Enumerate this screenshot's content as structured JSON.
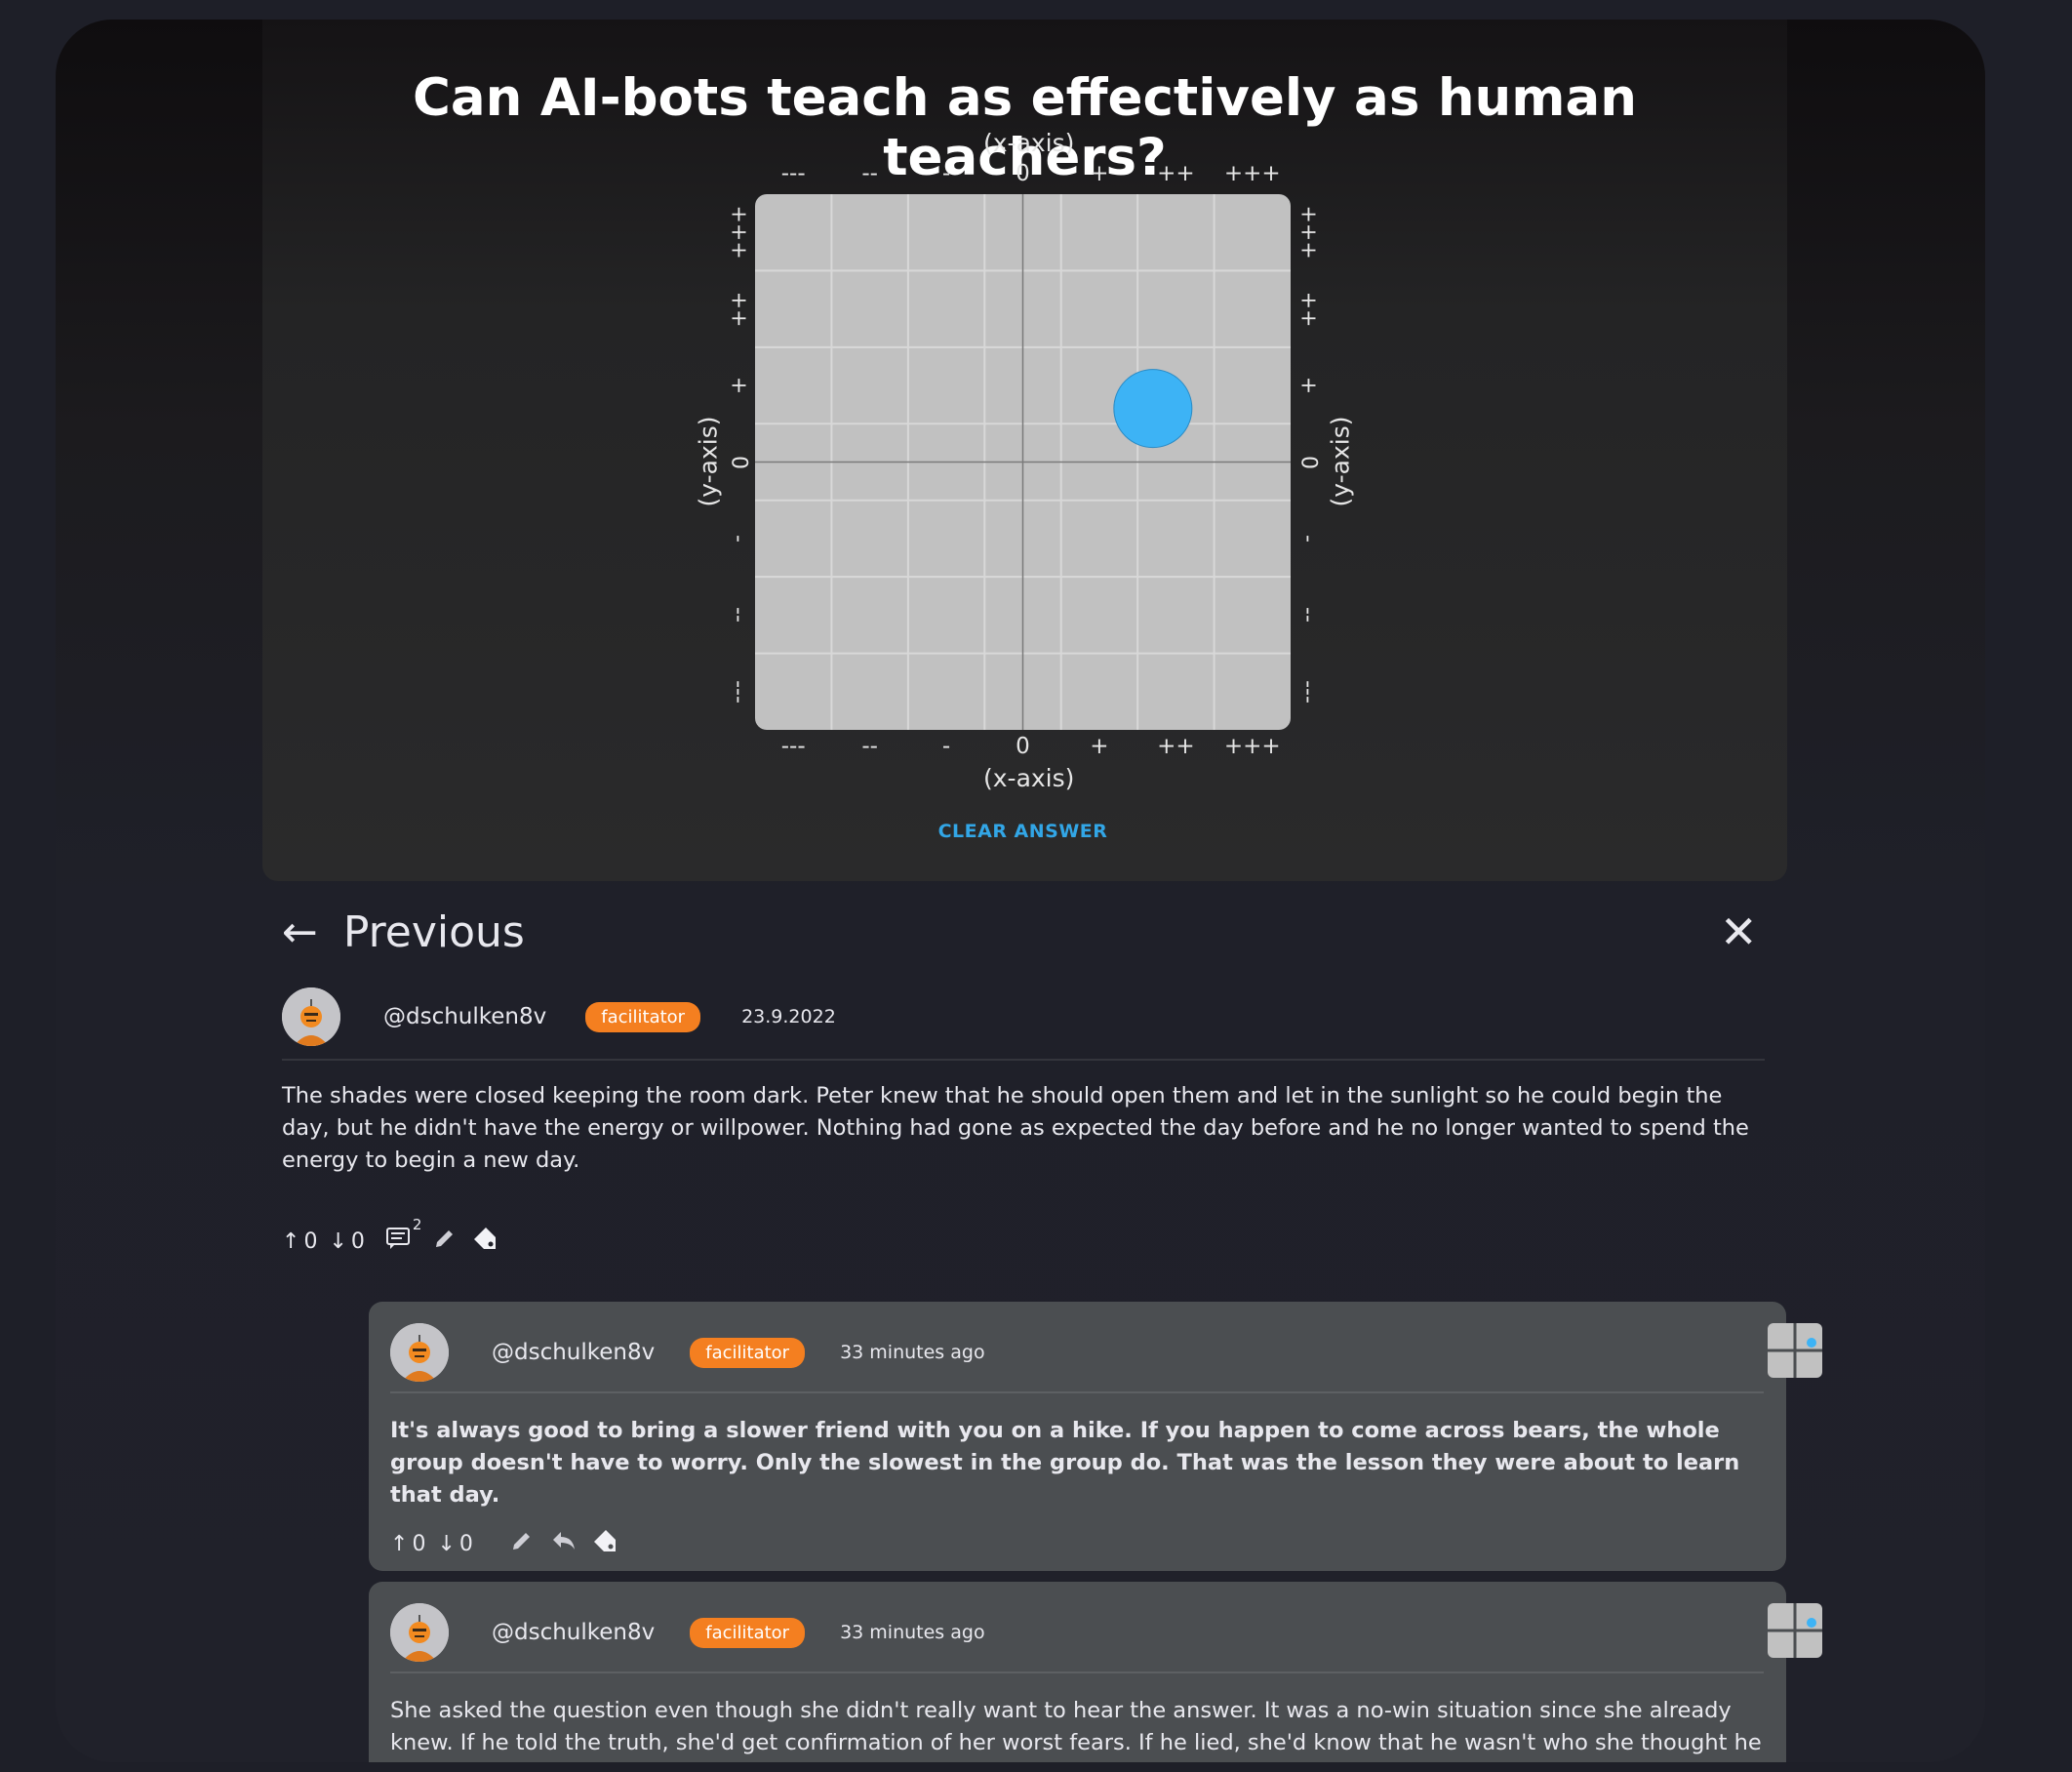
{
  "question": {
    "title": "Can AI-bots teach as effectively as human teachers?"
  },
  "chart": {
    "x_axis_label": "(x-axis)",
    "y_axis_label": "(y-axis)",
    "x_ticks": [
      "---",
      "--",
      "-",
      "0",
      "+",
      "++",
      "+++"
    ],
    "y_ticks": [
      "+++",
      "++",
      "+",
      "0",
      "-",
      "--",
      "---"
    ],
    "answer_dot": {
      "x": 2,
      "y": 1,
      "color": "#3db3f5"
    },
    "clear_label": "CLEAR ANSWER"
  },
  "nav": {
    "previous_label": "Previous"
  },
  "main_post": {
    "username": "@dschulken8v",
    "role": "facilitator",
    "date": "23.9.2022",
    "text": "The shades were closed keeping the room dark. Peter knew that he should open them and let in the sunlight so he could begin the day, but he didn't have the energy or willpower. Nothing had gone as expected the day before and he no longer wanted to spend the energy to begin a new day.",
    "upvotes": "0",
    "downvotes": "0",
    "comment_count": "2"
  },
  "replies": [
    {
      "username": "@dschulken8v",
      "role": "facilitator",
      "time": "33 minutes ago",
      "text": "It's always good to bring a slower friend with you on a hike. If you happen to come across bears, the whole group doesn't have to worry. Only the slowest in the group do. That was the lesson they were about to learn that day.",
      "upvotes": "0",
      "downvotes": "0"
    },
    {
      "username": "@dschulken8v",
      "role": "facilitator",
      "time": "33 minutes ago",
      "text": "She asked the question even though she didn't really want to hear the answer. It was a no-win situation since she already knew. If he told the truth, she'd get confirmation of her worst fears. If he lied, she'd know that he wasn't who she thought he was which"
    }
  ],
  "colors": {
    "accent_blue": "#32a6e6",
    "badge_orange": "#f47f20"
  },
  "icons": [
    "arrow-left-icon",
    "close-icon",
    "upvote-icon",
    "downvote-icon",
    "comment-icon",
    "pencil-icon",
    "tag-icon",
    "reply-icon",
    "mini-graph-icon"
  ]
}
